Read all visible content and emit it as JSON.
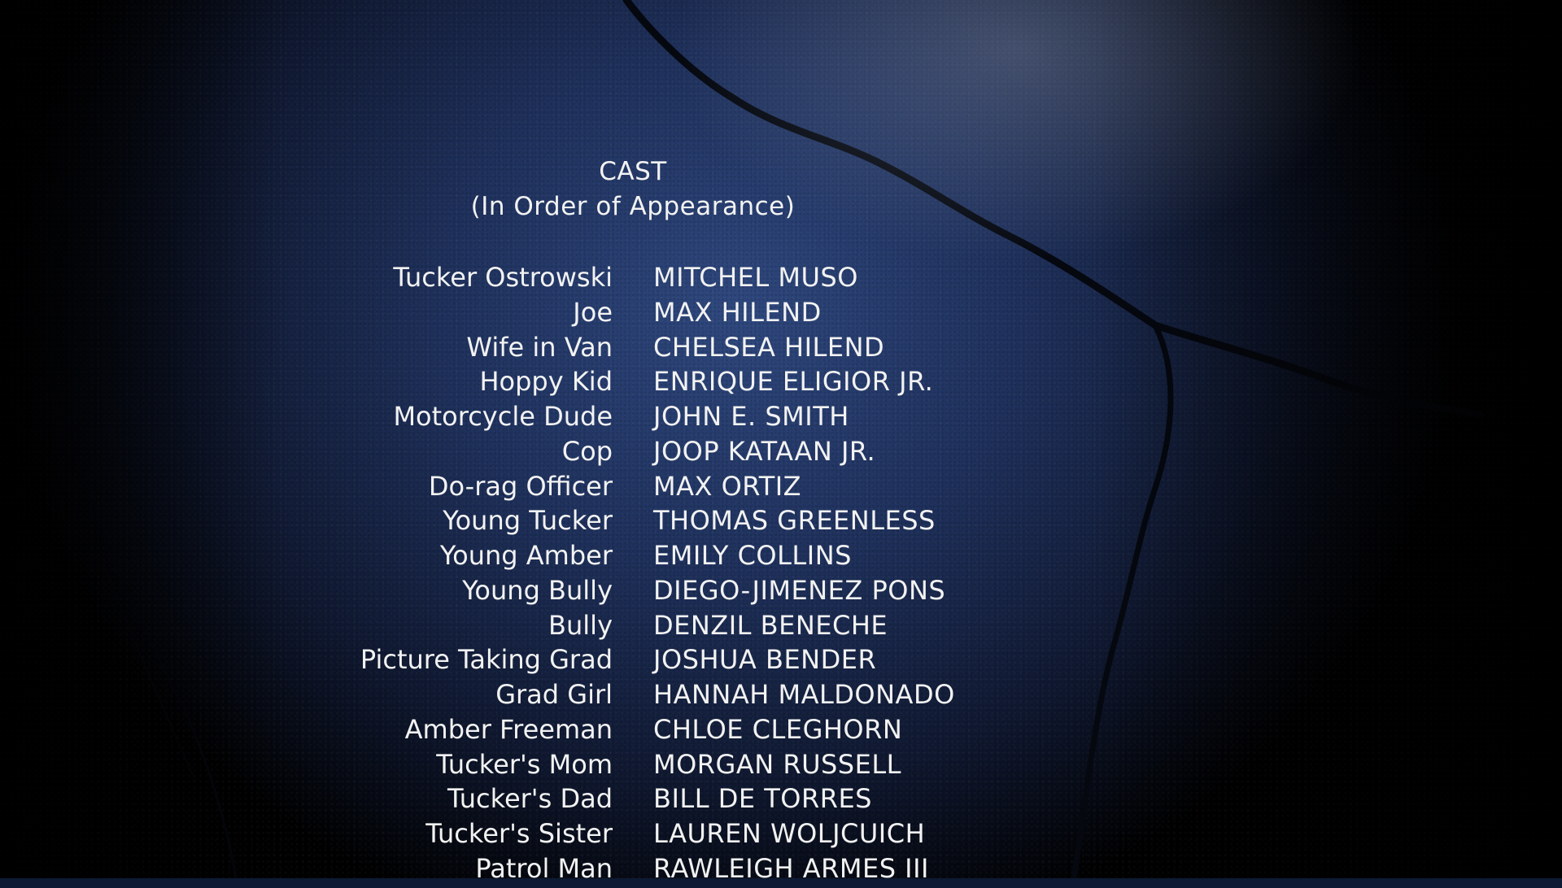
{
  "header": {
    "title": "CAST",
    "subtitle": "(In Order of Appearance)"
  },
  "cast": [
    {
      "role": "Tucker Ostrowski",
      "actor": "MITCHEL MUSO"
    },
    {
      "role": "Joe",
      "actor": "MAX HILEND"
    },
    {
      "role": "Wife in Van",
      "actor": "CHELSEA HILEND"
    },
    {
      "role": "Hoppy Kid",
      "actor": "ENRIQUE ELIGIOR JR."
    },
    {
      "role": "Motorcycle Dude",
      "actor": "JOHN E. SMITH"
    },
    {
      "role": "Cop",
      "actor": "JOOP KATAAN JR."
    },
    {
      "role": "Do-rag Officer",
      "actor": "MAX ORTIZ"
    },
    {
      "role": "Young Tucker",
      "actor": "THOMAS GREENLESS"
    },
    {
      "role": "Young Amber",
      "actor": "EMILY COLLINS"
    },
    {
      "role": "Young Bully",
      "actor": "DIEGO-JIMENEZ PONS"
    },
    {
      "role": "Bully",
      "actor": "DENZIL BENECHE"
    },
    {
      "role": "Picture Taking Grad",
      "actor": "JOSHUA BENDER"
    },
    {
      "role": "Grad Girl",
      "actor": "HANNAH MALDONADO"
    },
    {
      "role": "Amber Freeman",
      "actor": "CHLOE CLEGHORN"
    },
    {
      "role": "Tucker's Mom",
      "actor": "MORGAN RUSSELL"
    },
    {
      "role": "Tucker's Dad",
      "actor": "BILL DE TORRES"
    },
    {
      "role": "Tucker's Sister",
      "actor": "LAUREN WOLJCUICH"
    },
    {
      "role": "Patrol Man",
      "actor": "RAWLEIGH ARMES III"
    }
  ],
  "colors": {
    "text": "#f2f2f2",
    "background": "#24365f"
  }
}
